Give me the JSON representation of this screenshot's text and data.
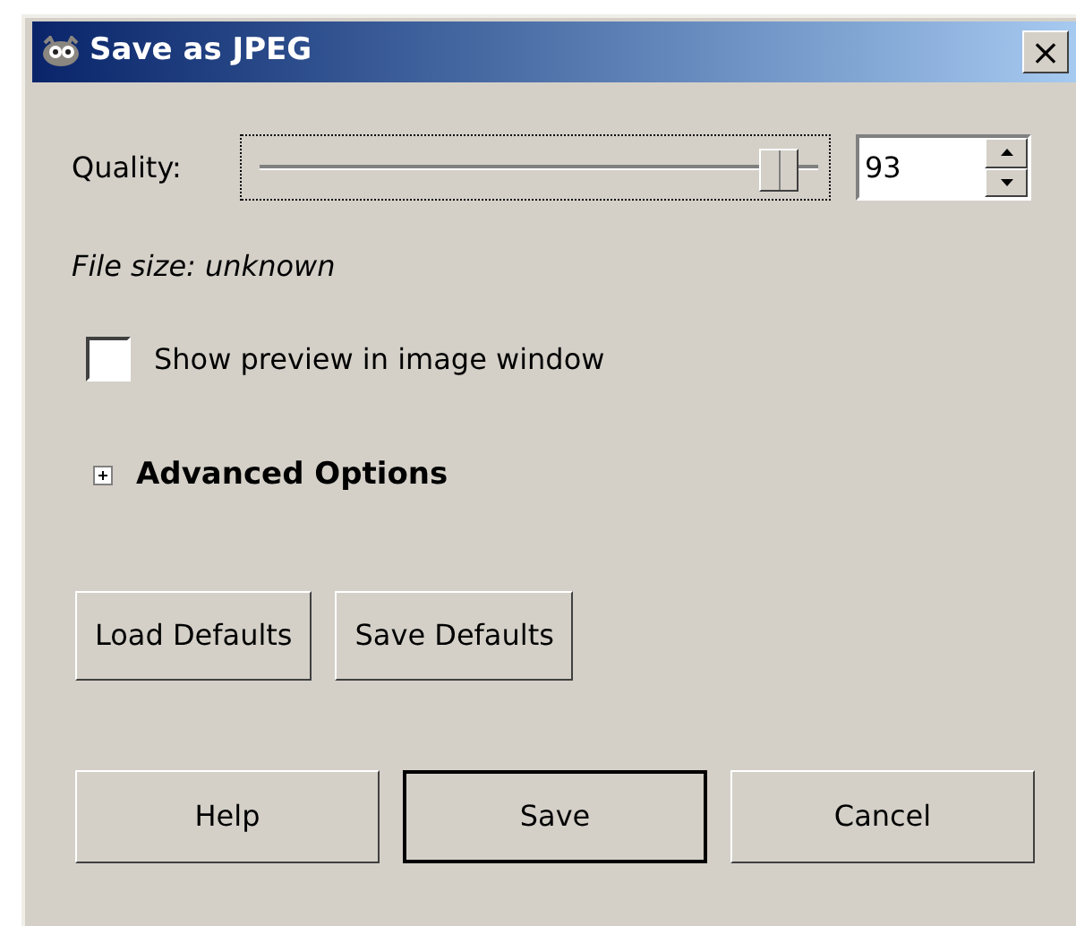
{
  "window": {
    "title": "Save as JPEG",
    "close": "×"
  },
  "quality": {
    "label": "Quality:",
    "level": 0.93,
    "value": "93"
  },
  "file_size": "File size: unknown",
  "preview_checkbox": {
    "label": "Show preview in image window",
    "checked": false
  },
  "advanced": {
    "label": "Advanced Options",
    "expanded": false
  },
  "defaults_buttons": [
    {
      "label": "Load Defaults"
    },
    {
      "label": "Save Defaults"
    }
  ],
  "buttons": [
    {
      "label": "Help",
      "default": false
    },
    {
      "label": "Save",
      "default": true
    },
    {
      "label": "Cancel",
      "default": false
    }
  ]
}
